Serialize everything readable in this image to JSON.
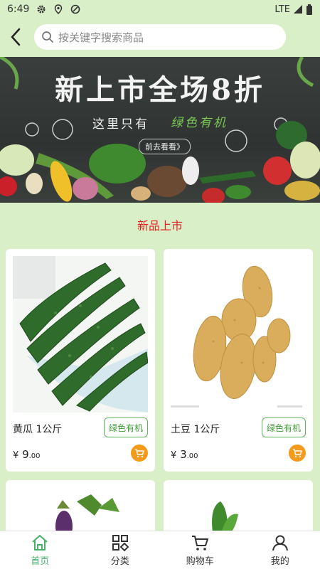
{
  "status_bar": {
    "time": "6:49",
    "network": "LTE"
  },
  "search": {
    "placeholder": "按关键字搜索商品"
  },
  "banner": {
    "headline": "新上市全场8折",
    "subline": "这里只有",
    "subline_highlight": "绿色有机",
    "button": "前去看看》"
  },
  "section": {
    "title": "新品上市"
  },
  "products": [
    {
      "name": "黄瓜 1公斤",
      "tag": "绿色有机",
      "currency": "¥",
      "price_int": "9",
      "price_dec": ".00"
    },
    {
      "name": "土豆 1公斤",
      "tag": "绿色有机",
      "currency": "¥",
      "price_int": "3",
      "price_dec": ".00"
    }
  ],
  "nav": {
    "items": [
      {
        "label": "首页",
        "icon": "home-icon"
      },
      {
        "label": "分类",
        "icon": "category-icon"
      },
      {
        "label": "购物车",
        "icon": "cart-icon"
      },
      {
        "label": "我的",
        "icon": "user-icon"
      }
    ],
    "active_color": "#45b36b"
  },
  "colors": {
    "background": "#d8efc7",
    "section_title": "#e02222",
    "tag": "#3e9c36",
    "cart_button": "#f59a1b"
  }
}
